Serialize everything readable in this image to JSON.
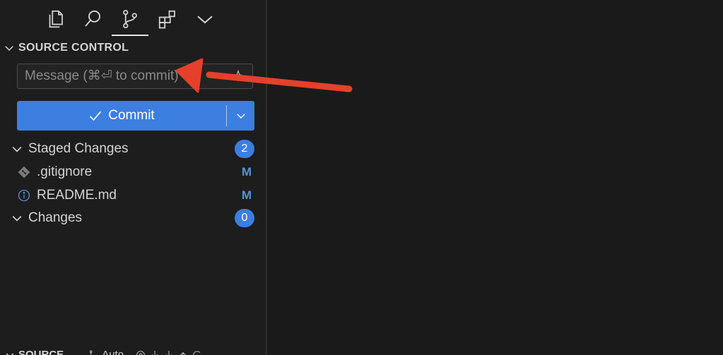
{
  "activity_tabs": [
    {
      "icon": "files-icon",
      "active": false
    },
    {
      "icon": "search-icon",
      "active": false
    },
    {
      "icon": "source-control-icon",
      "active": true
    },
    {
      "icon": "extensions-icon",
      "active": false
    },
    {
      "icon": "chevron-down-icon",
      "active": false
    }
  ],
  "section": {
    "title": "SOURCE CONTROL"
  },
  "message": {
    "placeholder": "Message (⌘⏎ to commit)",
    "value": ""
  },
  "commit_button": {
    "label": "Commit"
  },
  "staged": {
    "label": "Staged Changes",
    "count": "2",
    "files": [
      {
        "name": ".gitignore",
        "status": "M",
        "icon": "git-file-icon"
      },
      {
        "name": "README.md",
        "status": "M",
        "icon": "info-icon"
      }
    ]
  },
  "changes": {
    "label": "Changes",
    "count": "0"
  },
  "bottom": {
    "title": "SOURCE",
    "auto_label": "Auto"
  },
  "colors": {
    "accent": "#3c7fe0",
    "annotation_arrow": "#e5402b",
    "background": "#1d1d1d"
  }
}
